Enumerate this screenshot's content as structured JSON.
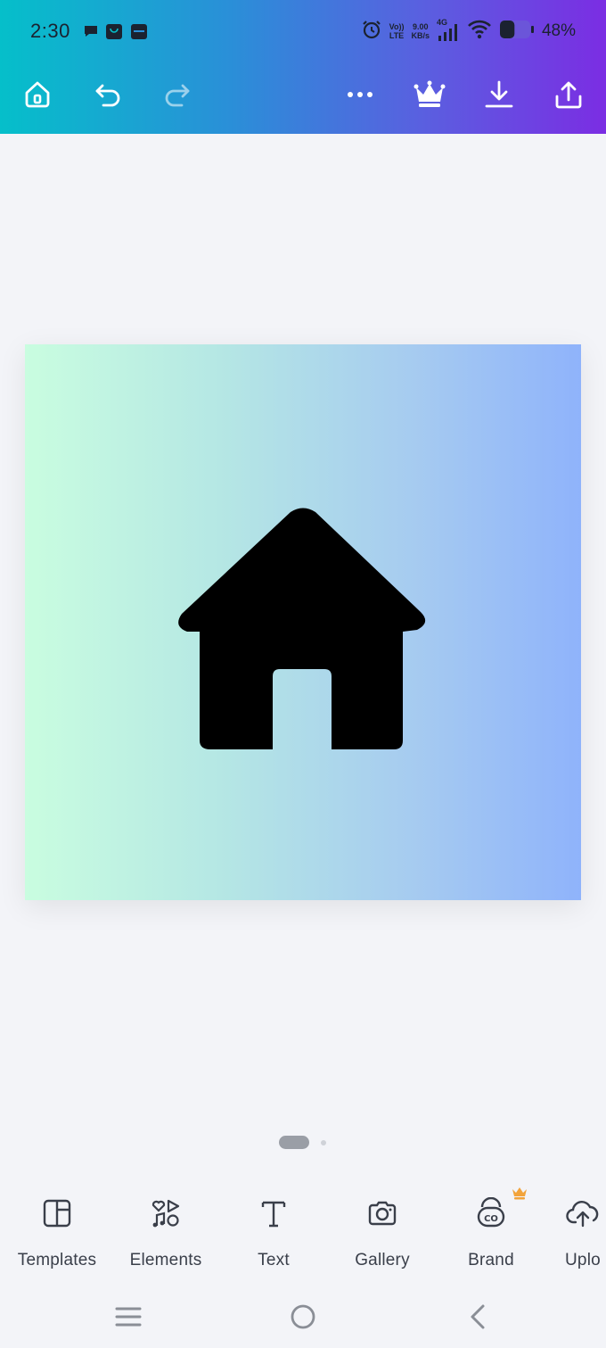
{
  "status_bar": {
    "time": "2:30",
    "volte_line1": "Vo))",
    "volte_line2": "LTE",
    "speed_value": "9.00",
    "speed_unit": "KB/s",
    "network": "4G",
    "battery_percent": "48%",
    "battery_level": 0.48
  },
  "toolbar": {
    "icons": [
      "home-icon",
      "undo-icon",
      "redo-icon",
      "more-icon",
      "crown-icon",
      "download-icon",
      "share-icon"
    ]
  },
  "design": {
    "gradient_colors": [
      "#c9fde0",
      "#a6cbf0",
      "#8fb3fb"
    ],
    "graphic": "house-icon"
  },
  "pager": {
    "pages": 2,
    "current": 1
  },
  "bottom_nav": {
    "items": [
      {
        "label": "Templates",
        "icon": "templates-icon"
      },
      {
        "label": "Elements",
        "icon": "elements-icon"
      },
      {
        "label": "Text",
        "icon": "text-icon"
      },
      {
        "label": "Gallery",
        "icon": "camera-icon"
      },
      {
        "label": "Brand",
        "icon": "brand-icon",
        "premium": true
      },
      {
        "label": "Uplo",
        "icon": "upload-icon"
      }
    ]
  },
  "colors": {
    "header_start": "#05bfca",
    "header_end": "#7b2de3",
    "premium_crown": "#f2a33a",
    "nav_text": "#3a3f4a"
  }
}
